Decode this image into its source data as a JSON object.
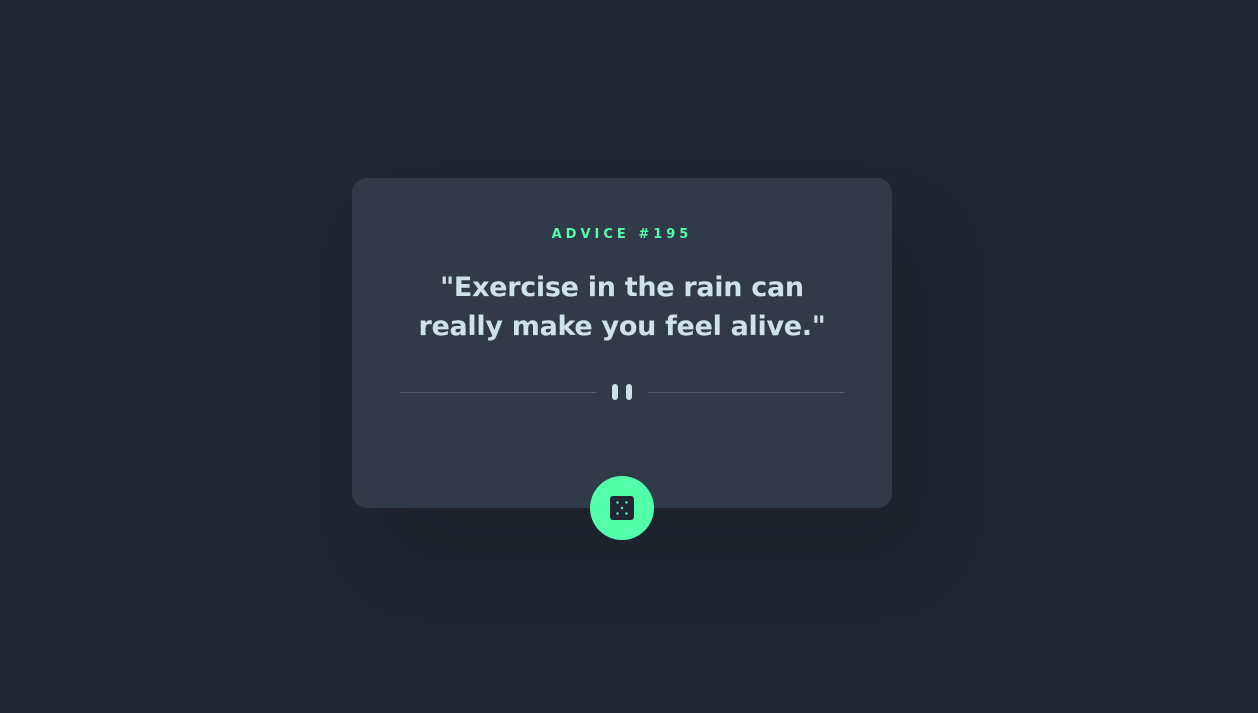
{
  "card": {
    "advice_label": "ADVICE #195",
    "advice_text": "\"Exercise in the rain can really make you feel alive.\""
  },
  "icons": {
    "divider": "pause-icon",
    "button": "dice-icon"
  },
  "colors": {
    "background": "#202632",
    "card": "#313a48",
    "accent": "#53ffaa",
    "text": "#cee3e9",
    "divider": "#4f5d74"
  }
}
